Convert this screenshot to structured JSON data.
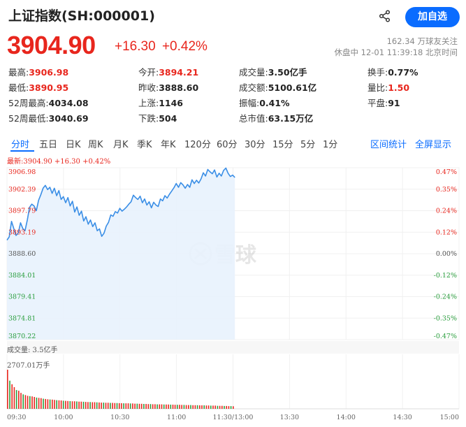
{
  "header": {
    "title": "上证指数(SH:000001)",
    "follow_label": "加自选",
    "share_icon": "share-icon"
  },
  "quote": {
    "price": "3904.90",
    "change": "+16.30",
    "change_pct": "+0.42%",
    "followers": "162.34 万球友关注",
    "status": "休盘中 12-01 11:39:18 北京时间"
  },
  "stats": [
    [
      {
        "k": "最高:",
        "v": "3906.98",
        "c": "up"
      },
      {
        "k": "今开:",
        "v": "3894.21",
        "c": "up"
      },
      {
        "k": "成交量:",
        "v": "3.50亿手",
        "c": ""
      },
      {
        "k": "换手:",
        "v": "0.77%",
        "c": ""
      }
    ],
    [
      {
        "k": "最低:",
        "v": "3890.95",
        "c": "up"
      },
      {
        "k": "昨收:",
        "v": "3888.60",
        "c": ""
      },
      {
        "k": "成交额:",
        "v": "5100.61亿",
        "c": ""
      },
      {
        "k": "量比:",
        "v": "1.50",
        "c": "up"
      }
    ],
    [
      {
        "k": "52周最高:",
        "v": "4034.08",
        "c": ""
      },
      {
        "k": "上涨:",
        "v": "1146",
        "c": ""
      },
      {
        "k": "振幅:",
        "v": "0.41%",
        "c": ""
      },
      {
        "k": "平盘:",
        "v": "91",
        "c": ""
      }
    ],
    [
      {
        "k": "52周最低:",
        "v": "3040.69",
        "c": ""
      },
      {
        "k": "下跌:",
        "v": "504",
        "c": ""
      },
      {
        "k": "总市值:",
        "v": "63.15万亿",
        "c": ""
      },
      {
        "k": "",
        "v": "",
        "c": ""
      }
    ]
  ],
  "tabs": [
    "分时",
    "五日",
    "日K",
    "周K",
    "月K",
    "季K",
    "年K",
    "120分",
    "60分",
    "30分",
    "15分",
    "5分",
    "1分"
  ],
  "tabs_right": [
    "区间统计",
    "全屏显示"
  ],
  "legend": "最新:3904.90 +16.30 +0.42%",
  "watermark": "雪球",
  "volume_label": "成交量: 3.5亿手",
  "volume_max": "2707.01万手",
  "colors": {
    "up": "#e8261d",
    "down": "#2a9e3d",
    "accent": "#0a6cff",
    "line": "#3a8ee6",
    "fill": "#e8f2fd"
  },
  "chart_data": {
    "type": "line",
    "title": "",
    "xlabel": "",
    "ylabel": "",
    "prev_close": 3888.6,
    "ylim": [
      3870.22,
      3906.98
    ],
    "y_ticks": [
      "3906.98",
      "3902.39",
      "3897.79",
      "3893.19",
      "3888.60",
      "3884.01",
      "3879.41",
      "3874.81",
      "3870.22"
    ],
    "pct_ticks": [
      "0.47%",
      "0.35%",
      "0.24%",
      "0.12%",
      "0.00%",
      "-0.12%",
      "-0.24%",
      "-0.35%",
      "-0.47%"
    ],
    "x_ticks": [
      "09:30",
      "10:00",
      "10:30",
      "11:00",
      "11:30/13:00",
      "13:30",
      "14:00",
      "14:30",
      "15:00"
    ],
    "series": [
      {
        "values": [
          3891.5,
          3892.2,
          3895.5,
          3894.0,
          3892.5,
          3893.0,
          3895.2,
          3894.0,
          3893.5,
          3895.8,
          3898.5,
          3899.2,
          3898.8,
          3897.8,
          3900.0,
          3901.2,
          3902.6,
          3903.2,
          3902.3,
          3902.8,
          3901.5,
          3902.6,
          3901.0,
          3902.1,
          3900.2,
          3900.8,
          3899.5,
          3900.6,
          3898.8,
          3899.8,
          3897.5,
          3898.6,
          3896.8,
          3897.7,
          3895.6,
          3896.5,
          3894.9,
          3895.8,
          3894.4,
          3895.2,
          3893.5,
          3893.9,
          3892.3,
          3893.0,
          3894.5,
          3895.3,
          3896.9,
          3896.6,
          3897.6,
          3897.3,
          3898.3,
          3897.7,
          3898.1,
          3898.6,
          3899.2,
          3899.7,
          3901.1,
          3900.6,
          3900.2,
          3900.9,
          3899.5,
          3900.3,
          3899.0,
          3899.7,
          3898.4,
          3899.6,
          3899.0,
          3898.7,
          3900.3,
          3899.9,
          3901.0,
          3900.5,
          3901.3,
          3902.0,
          3902.7,
          3903.6,
          3902.8,
          3903.8,
          3903.3,
          3902.6,
          3903.4,
          3902.8,
          3904.4,
          3903.6,
          3904.3,
          3903.7,
          3904.6,
          3905.9,
          3905.2,
          3906.6,
          3906.1,
          3905.7,
          3906.5,
          3905.0,
          3905.8,
          3905.2,
          3906.4,
          3906.9,
          3905.8,
          3905.1,
          3905.4,
          3904.9
        ]
      }
    ],
    "volume_series": {
      "name": "成交量",
      "max": 2707.01,
      "values": [
        2707,
        1950,
        1700,
        1500,
        1300,
        1250,
        1100,
        1000,
        950,
        900,
        880,
        860,
        820,
        780,
        760,
        740,
        700,
        680,
        660,
        650,
        640,
        620,
        600,
        590,
        580,
        560,
        550,
        540,
        530,
        520,
        520,
        510,
        500,
        500,
        490,
        480,
        470,
        470,
        460,
        460,
        450,
        440,
        430,
        430,
        420,
        420,
        410,
        410,
        400,
        400,
        390,
        390,
        380,
        380,
        380,
        370,
        370,
        360,
        360,
        350,
        350,
        340,
        340,
        330,
        330,
        320,
        320,
        310,
        310,
        310,
        300,
        300,
        300,
        290,
        290,
        280,
        280,
        280,
        270,
        270,
        260,
        260,
        260,
        250,
        250,
        250,
        240,
        240,
        240,
        230,
        230,
        220,
        220,
        220,
        210,
        210,
        210,
        200,
        200,
        190,
        190,
        180
      ]
    }
  }
}
